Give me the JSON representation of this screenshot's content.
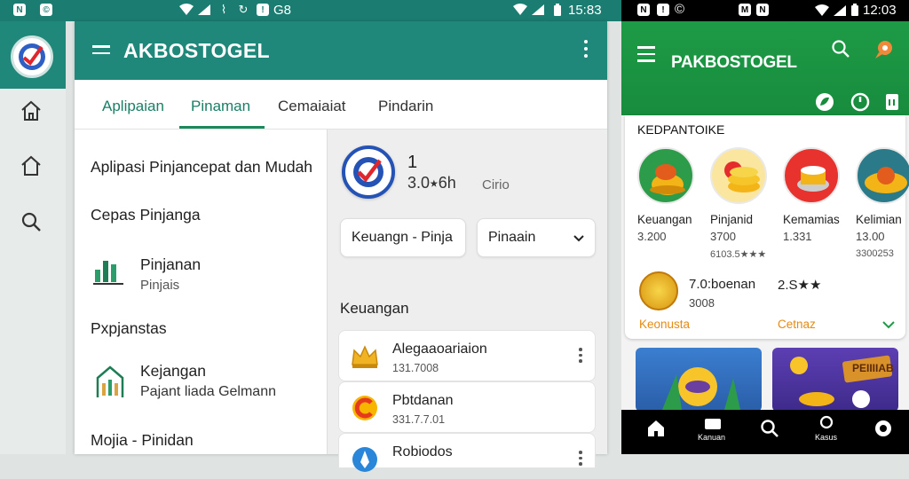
{
  "status_left": {
    "time": "15:83",
    "mid_text": "G8"
  },
  "phone1": {
    "app_title": "AKBOSTOGEL",
    "tabs": [
      {
        "label": "Aplipaian"
      },
      {
        "label": "Pinaman"
      },
      {
        "label": "Cemaiaiat"
      },
      {
        "label": "Pindarin"
      }
    ],
    "left_items": {
      "heading1": "Aplipasi Pinjancepat dan Mudah",
      "heading2": "Cepas Pinjanga",
      "item1_title": "Pinjanan",
      "item1_sub": "Pinjais",
      "heading3": "Pxpjanstas",
      "item2_title": "Kejangan",
      "item2_sub": "Pajant liada Gelmann",
      "heading4": "Mojia - Pinidan"
    },
    "app_info": {
      "number": "1",
      "rating": "3.0⭑6h",
      "extra": "Cirio"
    },
    "pill1": "Keuangn - Pinja",
    "pill2": "Pinaain",
    "section_title": "Keuangan",
    "cards": [
      {
        "title": "Alegaaoariaion",
        "sub": "131.7008"
      },
      {
        "title": "Pbtdanan",
        "sub": "331.7.7.01"
      },
      {
        "title": "Robiodos",
        "sub": ""
      }
    ]
  },
  "phone2": {
    "status_time": "12:03",
    "app_title": "PAKBOSTOGEL",
    "section_title": "KEDPANTOIKE",
    "categories": [
      {
        "name": "Keuangan",
        "value": "3.200",
        "rating": ""
      },
      {
        "name": "Pinjanid",
        "value": "3700",
        "rating": "6103.5★★★"
      },
      {
        "name": "Kemamias",
        "value": "1.331",
        "rating": ""
      },
      {
        "name": "Kelimian",
        "value": "13.00",
        "rating": "3300253"
      }
    ],
    "feature": {
      "title": "7.0:boenan",
      "value": "3008",
      "rating": "2.S★★"
    },
    "link_left": "Keonusta",
    "link_right": "Cetnaz",
    "promo2_label": "PEIIIIAB",
    "nav": [
      {
        "label": ""
      },
      {
        "label": "Kanuan"
      },
      {
        "label": ""
      },
      {
        "label": "Kasus"
      },
      {
        "label": ""
      }
    ]
  },
  "colors": {
    "teal": "#20877b",
    "green": "#1e9b46",
    "accent": "#1a7f66",
    "orange": "#e68a10"
  }
}
